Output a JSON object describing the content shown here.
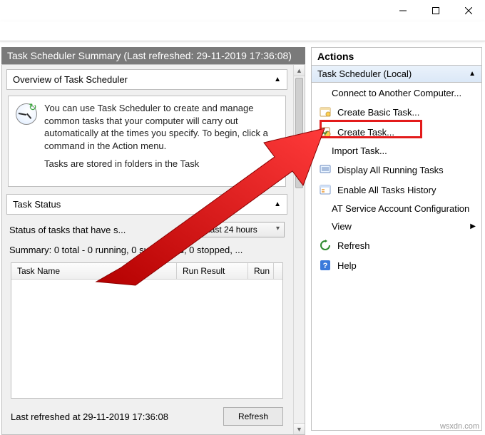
{
  "window": {
    "title_bar": {
      "min": "minimize",
      "max": "maximize",
      "close": "close"
    }
  },
  "summary_header": "Task Scheduler Summary (Last refreshed: 29-11-2019 17:36:08)",
  "overview": {
    "title": "Overview of Task Scheduler",
    "para1": "You can use Task Scheduler to create and manage common tasks that your computer will carry out automatically at the times you specify. To begin, click a command in the Action menu.",
    "para2_truncated": "Tasks are stored in folders in the Task"
  },
  "task_status": {
    "title": "Task Status",
    "label_truncated": "Status of tasks that have s...",
    "range_selected": "Last 24 hours",
    "summary_line": "Summary: 0 total - 0 running, 0 succeeded, 0 stopped, ...",
    "columns": [
      "Task Name",
      "Run Result",
      "Run"
    ]
  },
  "footer": {
    "last_refreshed": "Last refreshed at 29-11-2019 17:36:08",
    "refresh_btn": "Refresh"
  },
  "actions": {
    "pane_title": "Actions",
    "group_title": "Task Scheduler (Local)",
    "items": [
      {
        "label": "Connect to Another Computer...",
        "icon": "blank"
      },
      {
        "label": "Create Basic Task...",
        "icon": "wizard",
        "highlight": true
      },
      {
        "label": "Create Task...",
        "icon": "new-task"
      },
      {
        "label": "Import Task...",
        "icon": "blank"
      },
      {
        "label": "Display All Running Tasks",
        "icon": "display"
      },
      {
        "label": "Enable All Tasks History",
        "icon": "history"
      },
      {
        "label": "AT Service Account Configuration",
        "icon": "blank"
      },
      {
        "label": "View",
        "icon": "blank",
        "submenu": true
      },
      {
        "label": "Refresh",
        "icon": "refresh"
      },
      {
        "label": "Help",
        "icon": "help"
      }
    ]
  },
  "watermark": "wsxdn.com"
}
